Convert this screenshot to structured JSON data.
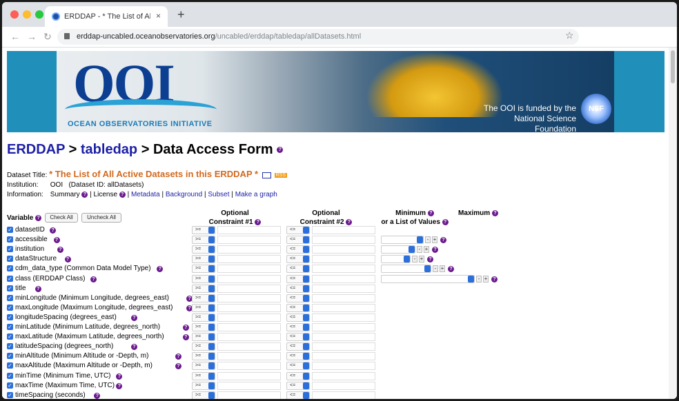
{
  "browser": {
    "tab_title": "ERDDAP - * The List of All Active Datasets in this ERDDAP *",
    "tab_close": "×",
    "new_tab": "+",
    "url_host": "erddap-uncabled.oceanobservatories.org",
    "url_path": "/uncabled/erddap/tabledap/allDatasets.html",
    "back": "←",
    "forward": "→",
    "reload": "↻",
    "star": "☆",
    "traffic_lights": [
      "#fd5f57",
      "#febc2e",
      "#28c840"
    ]
  },
  "banner": {
    "logo_text": "OOI",
    "org_name": "OCEAN OBSERVATORIES INITIATIVE",
    "funded_line1": "The OOI is funded by the",
    "funded_line2": "National Science Foundation",
    "nsf_text": "NSF"
  },
  "page": {
    "crumb_erddap": "ERDDAP",
    "sep1": " > ",
    "crumb_tabledap": "tabledap",
    "sep2": " > ",
    "title": "Data Access Form",
    "dataset_title_label": "Dataset Title:",
    "dataset_title": "* The List of All Active Datasets in this ERDDAP *",
    "rss": "RSS",
    "institution_label": "Institution:",
    "institution": "OOI",
    "dataset_id": "(Dataset ID: allDatasets)",
    "information_label": "Information:",
    "info_summary": "Summary",
    "info_license": "License",
    "info_metadata": "Metadata",
    "info_background": "Background",
    "info_subset": "Subset",
    "info_graph": "Make a graph",
    "sep_bar": "|"
  },
  "form": {
    "variable_label": "Variable",
    "check_all": "Check All",
    "uncheck_all": "Uncheck All",
    "optional": "Optional",
    "constraint1": "Constraint #1",
    "constraint2": "Constraint #2",
    "minimum": "Minimum",
    "list_of_values": "or a List of Values",
    "maximum": "Maximum",
    "op1": ">=",
    "op2": "<=",
    "plus": "+",
    "minus": "-",
    "check_mark": "✓",
    "qmark": "?",
    "variables": [
      "datasetID",
      "accessible",
      "institution",
      "dataStructure",
      "cdm_data_type (Common Data Model Type)",
      "class (ERDDAP Class)",
      "title",
      "minLongitude (Minimum Longitude, degrees_east)",
      "maxLongitude (Maximum Longitude, degrees_east)",
      "longitudeSpacing (degrees_east)",
      "minLatitude (Minimum Latitude, degrees_north)",
      "maxLatitude (Maximum Latitude, degrees_north)",
      "latitudeSpacing (degrees_north)",
      "minAltitude (Minimum Altitude or -Depth, m)",
      "maxAltitude (Maximum Altitude or -Depth, m)",
      "minTime (Minimum Time, UTC)",
      "maxTime (Maximum Time, UTC)",
      "timeSpacing (seconds)"
    ]
  }
}
